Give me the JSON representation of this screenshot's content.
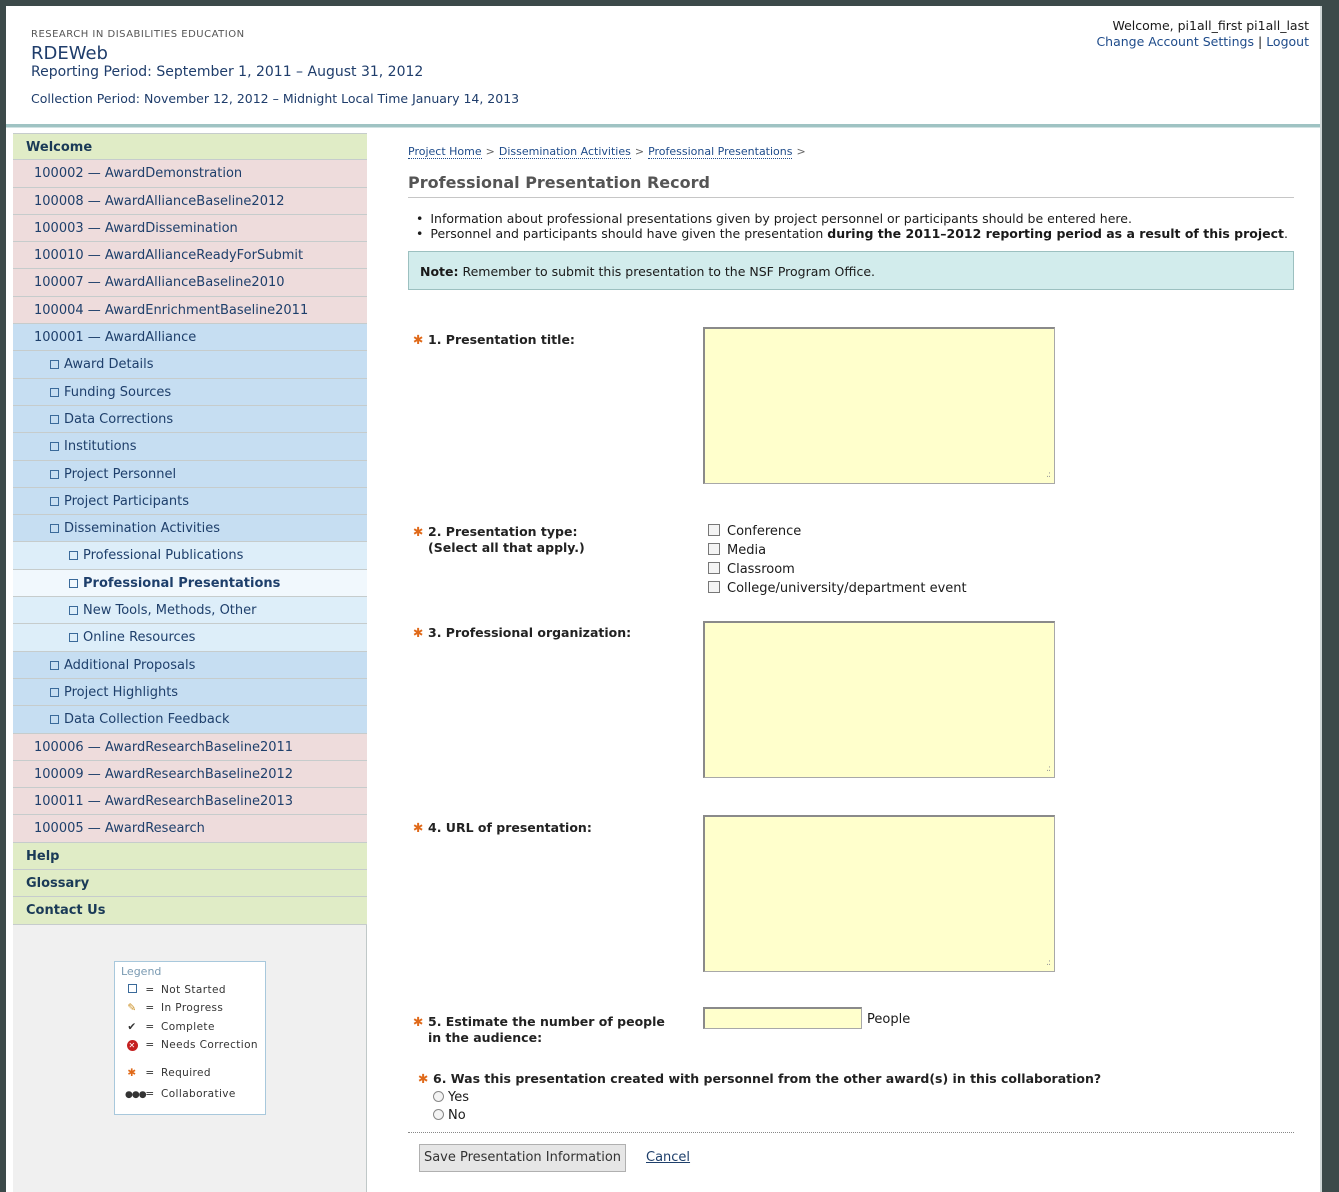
{
  "header": {
    "org": "RESEARCH IN DISABILITIES EDUCATION",
    "app_name": "RDEWeb",
    "reporting_period": "Reporting Period: September 1, 2011 – August 31, 2012",
    "collection_period": "Collection Period: November 12, 2012 – Midnight Local Time January 14, 2013",
    "welcome": "Welcome, pi1all_first pi1all_last",
    "account_settings": "Change Account Settings",
    "separator": "|",
    "logout": "Logout"
  },
  "sidebar": {
    "welcome": "Welcome",
    "awards_before": [
      "100002 — AwardDemonstration",
      "100008 — AwardAllianceBaseline2012",
      "100003 — AwardDissemination",
      "100010 — AwardAllianceReadyForSubmit",
      "100007 — AwardAllianceBaseline2010",
      "100004 — AwardEnrichmentBaseline2011"
    ],
    "active_award": "100001 — AwardAlliance",
    "sections_top": [
      "Award Details",
      "Funding Sources",
      "Data Corrections",
      "Institutions",
      "Project Personnel",
      "Project Participants",
      "Dissemination Activities"
    ],
    "dissemination_items": [
      "Professional Publications",
      "Professional Presentations",
      "New Tools, Methods, Other",
      "Online Resources"
    ],
    "sections_bottom": [
      "Additional Proposals",
      "Project Highlights",
      "Data Collection Feedback"
    ],
    "awards_after": [
      "100006 — AwardResearchBaseline2011",
      "100009 — AwardResearchBaseline2012",
      "100011 — AwardResearchBaseline2013",
      "100005 — AwardResearch"
    ],
    "help": "Help",
    "glossary": "Glossary",
    "contact": "Contact Us"
  },
  "legend": {
    "title": "Legend",
    "items": [
      "Not Started",
      "In Progress",
      "Complete",
      "Needs Correction",
      "Required",
      "Collaborative"
    ],
    "equals": "="
  },
  "breadcrumb": {
    "items": [
      "Project Home",
      "Dissemination Activities",
      "Professional Presentations"
    ],
    "sep": ">"
  },
  "page": {
    "title": "Professional Presentation Record",
    "bullet1": "Information about professional presentations given by project personnel or participants should be entered here.",
    "bullet2_a": "Personnel and participants should have given the presentation ",
    "bullet2_b": "during the 2011–2012 reporting period as a result of this project",
    "bullet2_c": ".",
    "note_label": "Note:",
    "note_text": " Remember to submit this presentation to the NSF Program Office."
  },
  "form": {
    "q1": "1. Presentation title:",
    "q2": "2. Presentation type:",
    "q2_sub": "(Select all that apply.)",
    "q2_options": [
      "Conference",
      "Media",
      "Classroom",
      "College/university/department event"
    ],
    "q3": "3. Professional organization:",
    "q4": "4. URL of presentation:",
    "q5": "5. Estimate the number of people",
    "q5_sub": "in the audience:",
    "q5_unit": "People",
    "q6": "6. Was this presentation created with personnel from the other award(s) in this collaboration?",
    "q6_options": [
      "Yes",
      "No"
    ],
    "save": "Save Presentation Information",
    "cancel": "Cancel"
  },
  "colors": {
    "accent_teal": "#9fc3c3",
    "required_star": "#e06a1a",
    "textarea_bg": "#ffffcc",
    "note_bg": "#d2ecec"
  }
}
